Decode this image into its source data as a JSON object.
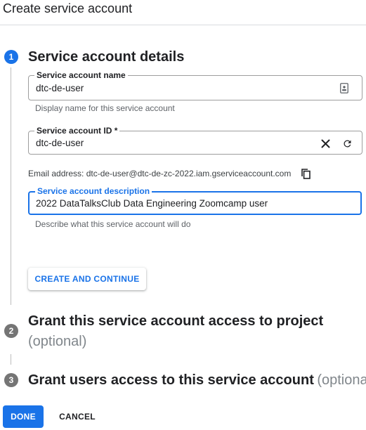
{
  "page": {
    "title": "Create service account"
  },
  "steps": [
    {
      "number": "1",
      "title": "Service account details"
    },
    {
      "number": "2",
      "title": "Grant this service account access to project",
      "optional": "(optional)"
    },
    {
      "number": "3",
      "title": "Grant users access to this service account",
      "optional": "(optional)"
    }
  ],
  "form": {
    "name": {
      "label": "Service account name",
      "value": "dtc-de-user",
      "hint": "Display name for this service account"
    },
    "id": {
      "label": "Service account ID *",
      "value": "dtc-de-user"
    },
    "email": {
      "text": "Email address: dtc-de-user@dtc-de-zc-2022.iam.gserviceaccount.com"
    },
    "description": {
      "label": "Service account description",
      "value": "2022 DataTalksClub Data Engineering Zoomcamp user",
      "hint": "Describe what this service account will do"
    }
  },
  "buttons": {
    "create_continue": "CREATE AND CONTINUE",
    "done": "DONE",
    "cancel": "CANCEL"
  },
  "icons": {
    "name_field": "badge-icon",
    "clear": "close-icon",
    "regenerate": "refresh-icon",
    "copy": "copy-icon"
  },
  "colors": {
    "accent": "#1a73e8",
    "inactive_step": "#757575"
  }
}
